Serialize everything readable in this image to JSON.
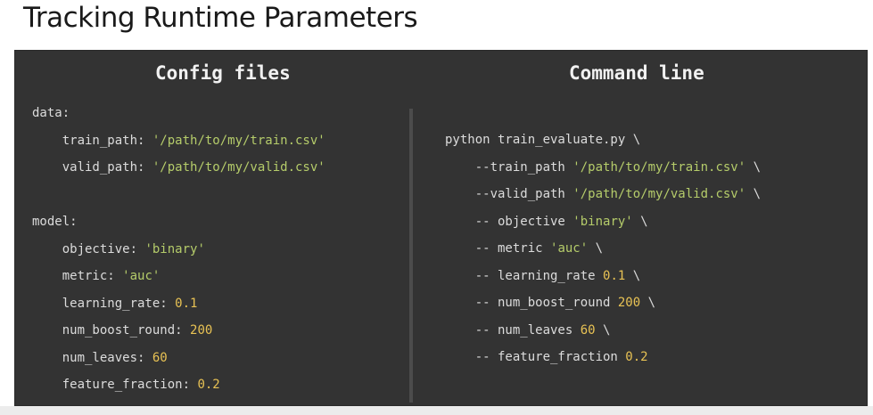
{
  "title": "Tracking Runtime Parameters",
  "colors": {
    "panel_bg": "#333333",
    "text": "#dcdcdc",
    "string": "#b5cc6a",
    "number": "#e8c254"
  },
  "config": {
    "heading": "Config files",
    "lines": [
      [
        {
          "t": "data:",
          "c": "txt"
        }
      ],
      [
        {
          "t": "    train_path: ",
          "c": "txt"
        },
        {
          "t": "'/path/to/my/train.csv'",
          "c": "str"
        }
      ],
      [
        {
          "t": "    valid_path: ",
          "c": "txt"
        },
        {
          "t": "'/path/to/my/valid.csv'",
          "c": "str"
        }
      ],
      [
        {
          "t": "",
          "c": "txt"
        }
      ],
      [
        {
          "t": "model:",
          "c": "txt"
        }
      ],
      [
        {
          "t": "    objective: ",
          "c": "txt"
        },
        {
          "t": "'binary'",
          "c": "str"
        }
      ],
      [
        {
          "t": "    metric: ",
          "c": "txt"
        },
        {
          "t": "'auc'",
          "c": "str"
        }
      ],
      [
        {
          "t": "    learning_rate: ",
          "c": "txt"
        },
        {
          "t": "0.1",
          "c": "num"
        }
      ],
      [
        {
          "t": "    num_boost_round: ",
          "c": "txt"
        },
        {
          "t": "200",
          "c": "num"
        }
      ],
      [
        {
          "t": "    num_leaves: ",
          "c": "txt"
        },
        {
          "t": "60",
          "c": "num"
        }
      ],
      [
        {
          "t": "    feature_fraction: ",
          "c": "txt"
        },
        {
          "t": "0.2",
          "c": "num"
        }
      ]
    ]
  },
  "cli": {
    "heading": "Command line",
    "lines": [
      [
        {
          "t": "python train_evaluate.py \\",
          "c": "txt"
        }
      ],
      [
        {
          "t": "    --train_path ",
          "c": "txt"
        },
        {
          "t": "'/path/to/my/train.csv'",
          "c": "str"
        },
        {
          "t": " \\",
          "c": "txt"
        }
      ],
      [
        {
          "t": "    --valid_path ",
          "c": "txt"
        },
        {
          "t": "'/path/to/my/valid.csv'",
          "c": "str"
        },
        {
          "t": " \\",
          "c": "txt"
        }
      ],
      [
        {
          "t": "    -- objective ",
          "c": "txt"
        },
        {
          "t": "'binary'",
          "c": "str"
        },
        {
          "t": " \\",
          "c": "txt"
        }
      ],
      [
        {
          "t": "    -- metric ",
          "c": "txt"
        },
        {
          "t": "'auc'",
          "c": "str"
        },
        {
          "t": " \\",
          "c": "txt"
        }
      ],
      [
        {
          "t": "    -- learning_rate ",
          "c": "txt"
        },
        {
          "t": "0.1",
          "c": "num"
        },
        {
          "t": " \\",
          "c": "txt"
        }
      ],
      [
        {
          "t": "    -- num_boost_round ",
          "c": "txt"
        },
        {
          "t": "200",
          "c": "num"
        },
        {
          "t": " \\",
          "c": "txt"
        }
      ],
      [
        {
          "t": "    -- num_leaves ",
          "c": "txt"
        },
        {
          "t": "60",
          "c": "num"
        },
        {
          "t": " \\",
          "c": "txt"
        }
      ],
      [
        {
          "t": "    -- feature_fraction ",
          "c": "txt"
        },
        {
          "t": "0.2",
          "c": "num"
        }
      ]
    ]
  }
}
